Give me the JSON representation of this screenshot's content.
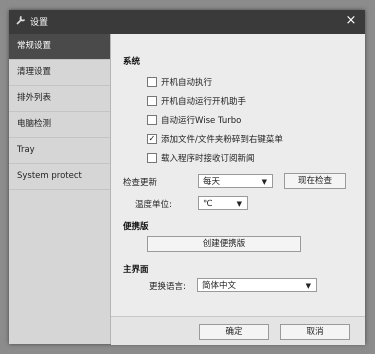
{
  "window": {
    "title": "设置",
    "close": "×",
    "title_icon": "wrench-icon"
  },
  "sidebar": {
    "items": [
      {
        "label": "常规设置",
        "active": true
      },
      {
        "label": "清理设置"
      },
      {
        "label": "排外列表"
      },
      {
        "label": "电脑检测"
      },
      {
        "label": "Tray"
      },
      {
        "label": "System protect"
      }
    ]
  },
  "system": {
    "title": "系统",
    "options": [
      {
        "label": "开机自动执行",
        "checked": false
      },
      {
        "label": "开机自动运行开机助手",
        "checked": false
      },
      {
        "label": "自动运行Wise Turbo",
        "checked": false
      },
      {
        "label": "添加文件/文件夹粉碎到右键菜单",
        "checked": true
      },
      {
        "label": "载入程序时接收订阅新闻",
        "checked": false
      }
    ],
    "update_label": "检查更新",
    "update_value": "每天",
    "check_now": "现在检查",
    "temp_label": "温度单位:",
    "temp_value": "℃"
  },
  "portable": {
    "title": "便携版",
    "create_button": "创建便携版"
  },
  "main_ui": {
    "title": "主界面",
    "language_label": "更换语言:",
    "language_value": "简体中文"
  },
  "footer": {
    "ok": "确定",
    "cancel": "取消"
  },
  "colors": {
    "titlebar": "#3a3a3a",
    "active_item": "#4a4a4a",
    "dialog_bg": "#ececec"
  }
}
